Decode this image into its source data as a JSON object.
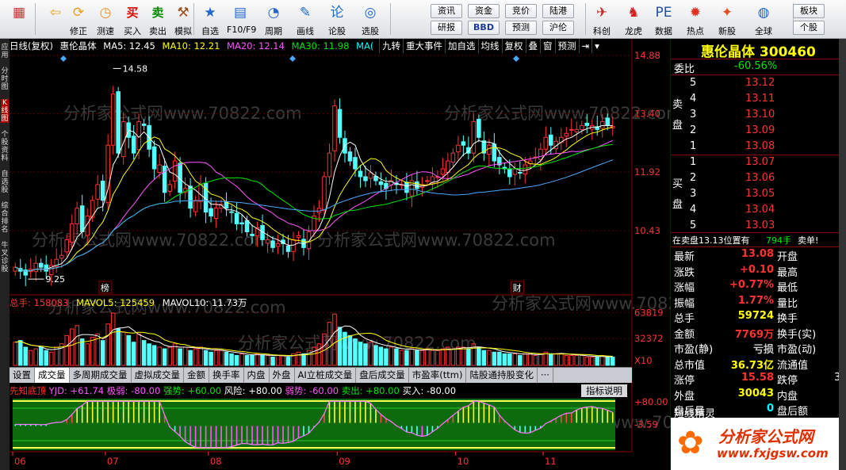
{
  "toolbar": {
    "items": [
      {
        "label": "",
        "icon": "home-icon"
      },
      {
        "label": "",
        "icon": "back-arrow-icon"
      },
      {
        "label": "修正",
        "icon": "refresh-icon"
      },
      {
        "label": "测速",
        "icon": "clock-icon"
      },
      {
        "label": "买入",
        "icon": "buy-icon",
        "glyph": "买"
      },
      {
        "label": "卖出",
        "icon": "sell-icon",
        "glyph": "卖"
      },
      {
        "label": "模拟",
        "icon": "hammer-icon"
      },
      {
        "label": "自选",
        "icon": "star-icon"
      },
      {
        "label": "F10/F9",
        "icon": "f10-icon"
      },
      {
        "label": "周期",
        "icon": "cycle-icon"
      },
      {
        "label": "画线",
        "icon": "pen-icon"
      },
      {
        "label": "论股",
        "icon": "chat-icon",
        "glyph": "论"
      },
      {
        "label": "选股",
        "icon": "picker-icon"
      },
      {
        "label": "科创",
        "icon": "rocket-icon"
      },
      {
        "label": "龙虎",
        "icon": "dragon-icon"
      },
      {
        "label": "数据",
        "icon": "pe-icon",
        "glyph": "PE"
      },
      {
        "label": "热点",
        "icon": "fire-icon"
      },
      {
        "label": "新股",
        "icon": "ipo-icon"
      },
      {
        "label": "全球",
        "icon": "globe-icon"
      }
    ],
    "mini_buttons": [
      "资讯",
      "资金",
      "竞价",
      "陆港",
      "研报",
      "BBD",
      "预测",
      "沪伦",
      "板块",
      "个股"
    ]
  },
  "left_strip_tabs": [
    "应用",
    "分时图",
    "K线图",
    "个股资料",
    "自选股",
    "综合排名",
    "牛叉诊股"
  ],
  "chart_header": {
    "prefix": "日线(复权)",
    "name": "惠伦晶体",
    "ma5": "MA5: 12.45",
    "ma10": "MA10: 12.21",
    "ma20": "MA20: 12.14",
    "ma30": "MA30: 11.98",
    "ma60": "MA("
  },
  "header_tabs": [
    "九转",
    "重大事件",
    "加自选",
    "均线",
    "复权",
    "叠",
    "窗",
    "预测"
  ],
  "price_axis": [
    "14.88",
    "13.40",
    "11.92",
    "10.43"
  ],
  "volume_axis": [
    "63819",
    "32372",
    "X10"
  ],
  "indicator_axis": [
    "+80.00",
    "-3.59"
  ],
  "chart_annotations": {
    "high_label": "14.58",
    "low_label": "9.25",
    "mark_bang": "榜",
    "mark_cai": "财"
  },
  "watermark": "分析家公式网www.70822.com",
  "volume_header": {
    "total": "总手: 158083",
    "mavol5": "MAVOL5: 125459",
    "mavol10": "MAVOL10: 11.73万"
  },
  "bottom_tabs": [
    "设置",
    "成交量",
    "多周期成交量",
    "虚拟成交量",
    "金额",
    "换手率",
    "内盘",
    "外盘",
    "AI立桩成交量",
    "盘后成交量",
    "市盈率(ttm)",
    "陆股通持股变化",
    "···"
  ],
  "indicator_header": {
    "name": "先知底顶",
    "yjd": "YJD: +61.74",
    "jiruo": "极弱: -80.00",
    "qiangshi": "强势: +60.00",
    "fengxian": "风险: +80.00",
    "ruoshi": "弱势: -60.00",
    "maichu": "卖出: +80.00",
    "mairu": "买入: -80.00",
    "help": "指标说明"
  },
  "date_axis": [
    "06",
    "07",
    "08",
    "09",
    "10",
    "11"
  ],
  "quote": {
    "title": "惠伦晶体 300460",
    "weibi_label": "委比",
    "weibi": "-60.56%",
    "sell_label": "卖盘",
    "buy_label": "买盘",
    "sells": [
      {
        "lvl": "5",
        "price": "13.12"
      },
      {
        "lvl": "4",
        "price": "13.11"
      },
      {
        "lvl": "3",
        "price": "13.10"
      },
      {
        "lvl": "2",
        "price": "13.09"
      },
      {
        "lvl": "1",
        "price": "13.08"
      }
    ],
    "buys": [
      {
        "lvl": "1",
        "price": "13.07"
      },
      {
        "lvl": "2",
        "price": "13.06"
      },
      {
        "lvl": "3",
        "price": "13.05"
      },
      {
        "lvl": "4",
        "price": "13.04"
      },
      {
        "lvl": "5",
        "price": "13.03"
      }
    ],
    "notice_left": "在卖盘13.13位置有",
    "notice_mid": "794手",
    "notice_right": "卖单!",
    "stats": [
      {
        "l": "最新",
        "v": "13.08",
        "r": "开盘"
      },
      {
        "l": "涨跌",
        "v": "+0.10",
        "r": "最高"
      },
      {
        "l": "涨幅",
        "v": "+0.77%",
        "r": "最低"
      },
      {
        "l": "振幅",
        "v": "1.77%",
        "r": "量比"
      },
      {
        "l": "总手",
        "v": "59724",
        "r": "换手"
      },
      {
        "l": "金额",
        "v": "7769万",
        "r": "换手(实)"
      },
      {
        "l": "市盈(静)",
        "v": "亏损",
        "r": "市盈(动)"
      },
      {
        "l": "总市值",
        "v": "36.73亿",
        "r": "流通值"
      },
      {
        "l": "涨停",
        "v": "15.58",
        "r": "跌停"
      },
      {
        "l": "外盘",
        "v": "30043",
        "r": "内盘"
      },
      {
        "l": "盘后量",
        "v": "0",
        "r": "盘后额"
      }
    ],
    "stat_extra": "3",
    "duanxian": "短线精灵",
    "logo_text": "分析家公式网",
    "logo_url": "www.fxjgsw.com"
  },
  "chart_data": {
    "type": "candlestick",
    "ylim": [
      9.0,
      14.88
    ],
    "close_series": [
      9.5,
      9.4,
      9.3,
      9.45,
      9.6,
      9.5,
      9.4,
      9.55,
      9.7,
      9.8,
      10.2,
      10.6,
      11.0,
      10.4,
      10.8,
      11.2,
      11.6,
      11.2,
      12.6,
      13.9,
      12.4,
      13.2,
      12.8,
      12.4,
      13.2,
      13.1,
      12.5,
      12.0,
      12.1,
      11.4,
      11.6,
      12.2,
      11.4,
      11.5,
      11.0,
      11.2,
      11.6,
      10.9,
      10.8,
      11.0,
      11.1,
      11.0,
      10.9,
      10.6,
      10.6,
      10.4,
      10.3,
      10.5,
      10.2,
      10.2,
      10.0,
      10.1,
      10.1,
      9.9,
      10.2,
      10.3,
      10.0,
      10.4,
      10.8,
      11.0,
      11.8,
      12.4,
      13.6,
      12.8,
      12.4,
      12.2,
      12.0,
      11.8,
      11.7,
      11.9,
      11.7,
      11.6,
      11.5,
      11.7,
      11.6,
      11.6,
      11.4,
      11.7,
      11.5,
      11.6,
      11.7,
      11.8,
      11.8,
      12.0,
      12.2,
      12.4,
      12.6,
      12.6,
      12.4,
      13.2,
      12.8,
      12.4,
      12.6,
      12.2,
      12.1,
      12.0,
      11.8,
      12.0,
      11.9,
      12.1,
      12.2,
      12.3,
      12.5,
      12.8,
      12.6,
      12.7,
      12.8,
      12.9,
      13.0,
      13.0,
      13.1,
      13.1,
      13.1,
      13.0,
      13.2,
      13.1,
      13.08
    ],
    "volume_series": [
      28,
      30,
      22,
      18,
      20,
      22,
      18,
      16,
      22,
      26,
      36,
      44,
      48,
      32,
      26,
      34,
      38,
      30,
      50,
      63,
      44,
      40,
      36,
      28,
      38,
      30,
      26,
      24,
      22,
      20,
      22,
      26,
      20,
      22,
      18,
      20,
      22,
      18,
      16,
      18,
      18,
      16,
      14,
      12,
      14,
      12,
      12,
      14,
      12,
      12,
      10,
      12,
      12,
      10,
      14,
      16,
      14,
      18,
      22,
      26,
      38,
      52,
      62,
      46,
      40,
      36,
      32,
      28,
      26,
      28,
      24,
      22,
      20,
      22,
      20,
      18,
      18,
      20,
      18,
      18,
      20,
      18,
      18,
      20,
      22,
      20,
      22,
      22,
      20,
      26,
      22,
      18,
      18,
      16,
      16,
      14,
      14,
      14,
      12,
      14,
      14,
      12,
      14,
      16,
      14,
      14,
      14,
      12,
      12,
      12,
      12,
      10,
      10,
      10,
      12,
      10,
      10
    ]
  }
}
